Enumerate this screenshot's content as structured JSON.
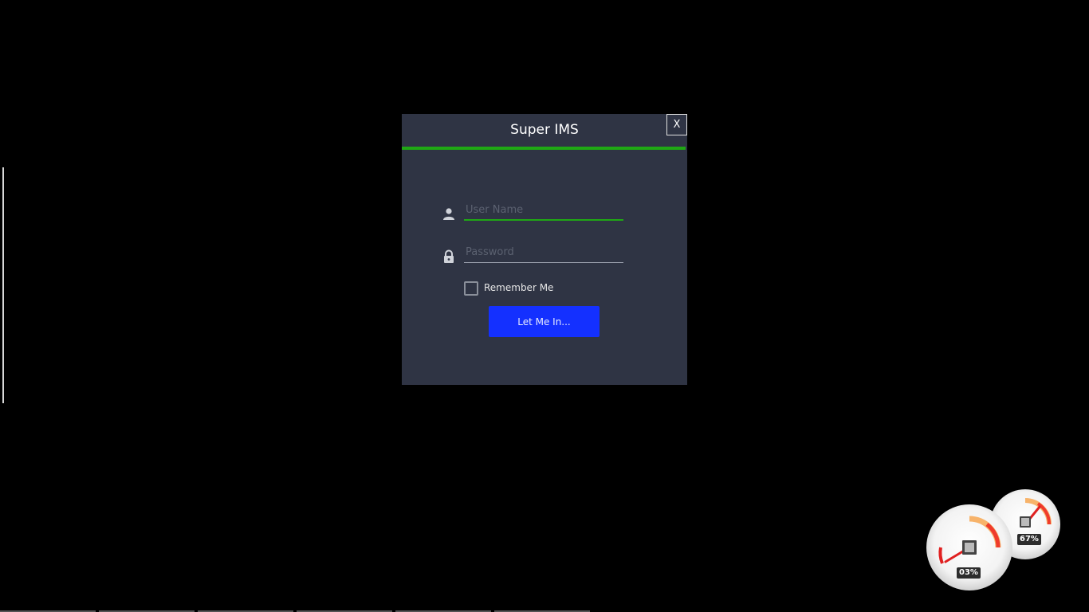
{
  "dialog": {
    "title": "Super IMS",
    "close_label": "X",
    "accent_color": "#1fa814",
    "background_color": "#2f3444",
    "username": {
      "icon": "user-icon",
      "placeholder": "User Name",
      "value": ""
    },
    "password": {
      "icon": "lock-icon",
      "placeholder": "Password",
      "value": ""
    },
    "remember": {
      "label": "Remember Me",
      "checked": false
    },
    "login_button": {
      "label": "Let Me In...",
      "color": "#1430ff"
    }
  },
  "gauges": {
    "cpu": {
      "icon": "cpu-icon",
      "value_label": "03%",
      "value": 3
    },
    "memory": {
      "icon": "memory-icon",
      "value_label": "67%",
      "value": 67
    }
  }
}
